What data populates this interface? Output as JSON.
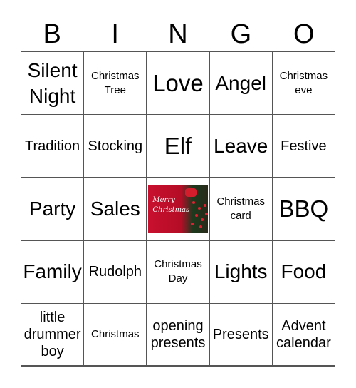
{
  "title_letters": [
    "B",
    "I",
    "N",
    "G",
    "O"
  ],
  "cells": [
    {
      "text": "Silent Night",
      "size": "l"
    },
    {
      "text": "Christmas Tree",
      "size": "s"
    },
    {
      "text": "Love",
      "size": "x"
    },
    {
      "text": "Angel",
      "size": "l"
    },
    {
      "text": "Christmas eve",
      "size": "s"
    },
    {
      "text": "Tradition",
      "size": "m"
    },
    {
      "text": "Stocking",
      "size": "m"
    },
    {
      "text": "Elf",
      "size": "x"
    },
    {
      "text": "Leave",
      "size": "l"
    },
    {
      "text": "Festive",
      "size": "m"
    },
    {
      "text": "Party",
      "size": "l"
    },
    {
      "text": "Sales",
      "size": "l"
    },
    {
      "text": "",
      "image": "merry-christmas-image",
      "image_caption": "Merry Christmas"
    },
    {
      "text": "Christmas card",
      "size": "s"
    },
    {
      "text": "BBQ",
      "size": "x"
    },
    {
      "text": "Family",
      "size": "l"
    },
    {
      "text": "Rudolph",
      "size": "m"
    },
    {
      "text": "Christmas Day",
      "size": "s"
    },
    {
      "text": "Lights",
      "size": "l"
    },
    {
      "text": "Food",
      "size": "l"
    },
    {
      "text": "little drummer boy",
      "size": "m"
    },
    {
      "text": "Christmas",
      "size": "s"
    },
    {
      "text": "opening presents",
      "size": "m"
    },
    {
      "text": "Presents",
      "size": "m"
    },
    {
      "text": "Advent calendar",
      "size": "m"
    }
  ]
}
